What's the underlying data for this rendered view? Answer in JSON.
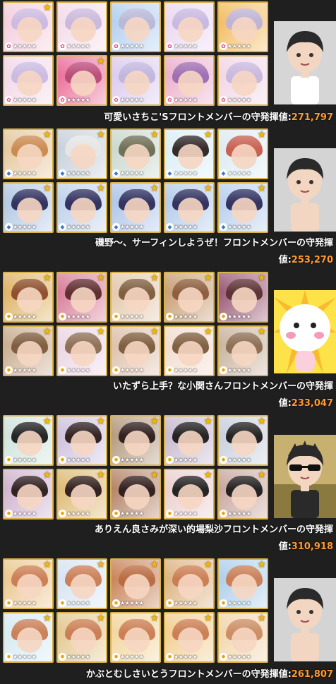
{
  "teams": [
    {
      "name_line": "可愛いさちこ'Sフロントメンバーの守発揮値:",
      "value": "271,797",
      "type": "cute",
      "type_color": "#e0408a",
      "hair_colors": [
        "#c9b8e0",
        "#c7b6dc",
        "#b8b6d6",
        "#c5b6de",
        "#bdb2d8",
        "#c9b8e0",
        "#b84a78",
        "#c0b4dc",
        "#9a6ab0",
        "#c6b6de"
      ],
      "bg_colors": [
        "#f3c7d8",
        "#f2d7e6",
        "#a9c9ee",
        "#e7d3ee",
        "#f2b24c",
        "#f0d3e4",
        "#e85a8a",
        "#d6c3ec",
        "#e9a4c4",
        "#f0d0e0"
      ],
      "avatar": "girl"
    },
    {
      "name_line_1": "磯野〜、サーフィンしようぜ！フロントメンバーの守発揮",
      "name_line_2": "値:",
      "value": "253,270",
      "type": "cool",
      "type_color": "#3a78d8",
      "hair_colors": [
        "#c9884c",
        "#e6e6e6",
        "#6a6a50",
        "#2a2020",
        "#c65a4a",
        "#2a2a5a",
        "#2a2a5a",
        "#2a2a5a",
        "#2a2a5a",
        "#2a2a5a"
      ],
      "bg_colors": [
        "#e0c090",
        "#bfc9d6",
        "#c2d2c8",
        "#d6ecf5",
        "#d8e8f0",
        "#a8c0e0",
        "#b6cae8",
        "#a3bde6",
        "#a8c4e6",
        "#aec8ec"
      ],
      "avatar": "boy"
    },
    {
      "name_line_1": "いたずら上手？な小関さんフロントメンバーの守発揮",
      "name_line_2": "値:",
      "value": "233,047",
      "type": "passion",
      "type_color": "#e8a000",
      "hair_colors": [
        "#8a4a2a",
        "#5a2a2a",
        "#7a5a3a",
        "#8a5a3a",
        "#5a3030",
        "#7a5a3a",
        "#8a6a50",
        "#7a5a3a",
        "#7a5a3a",
        "#8a6a50"
      ],
      "bg_colors": [
        "#d9a850",
        "#d26a8a",
        "#e0c0a0",
        "#c09060",
        "#8a4060",
        "#c0a080",
        "#e8d0e0",
        "#d8b8a0",
        "#f0d8c8",
        "#c0a890"
      ],
      "avatar": "mascot"
    },
    {
      "name_line_1": "ありえん良さみが深い的場梨沙フロントメンバーの守発揮",
      "name_line_2": "値:",
      "value": "310,918",
      "type": "passion",
      "type_color": "#e8a000",
      "hair_colors": [
        "#1a1a1a",
        "#2a1a1a",
        "#2a1a1a",
        "#1a1a1a",
        "#1a1a1a",
        "#2a1a1a",
        "#2a1a1a",
        "#2a1a1a",
        "#1a1a1a",
        "#1a1a1a"
      ],
      "bg_colors": [
        "#c8e0d8",
        "#c8b8d8",
        "#a88a6a",
        "#c0b0c8",
        "#c0c8d8",
        "#c8a8c8",
        "#d8b060",
        "#a87050",
        "#e8c8c8",
        "#c09890"
      ],
      "avatar": "sunglasses"
    },
    {
      "name_line": "かぶとむしさいとうフロントメンバーの守発揮値:",
      "value": "261,807",
      "type": "passion",
      "type_color": "#e8a000",
      "hair_colors": [
        "#c97a50",
        "#c97a50",
        "#b86a40",
        "#c97a50",
        "#c97a50",
        "#c97a50",
        "#c97a50",
        "#c97a50",
        "#c97a50",
        "#c98a60"
      ],
      "bg_colors": [
        "#e8c080",
        "#d0e0f0",
        "#c07040",
        "#d8a870",
        "#a0c8e8",
        "#d0e8f0",
        "#e0c080",
        "#f0d090",
        "#f0c880",
        "#f0d0a0"
      ],
      "avatar": "boy"
    }
  ],
  "card_stars": "★★★★★",
  "rank_star": "★"
}
